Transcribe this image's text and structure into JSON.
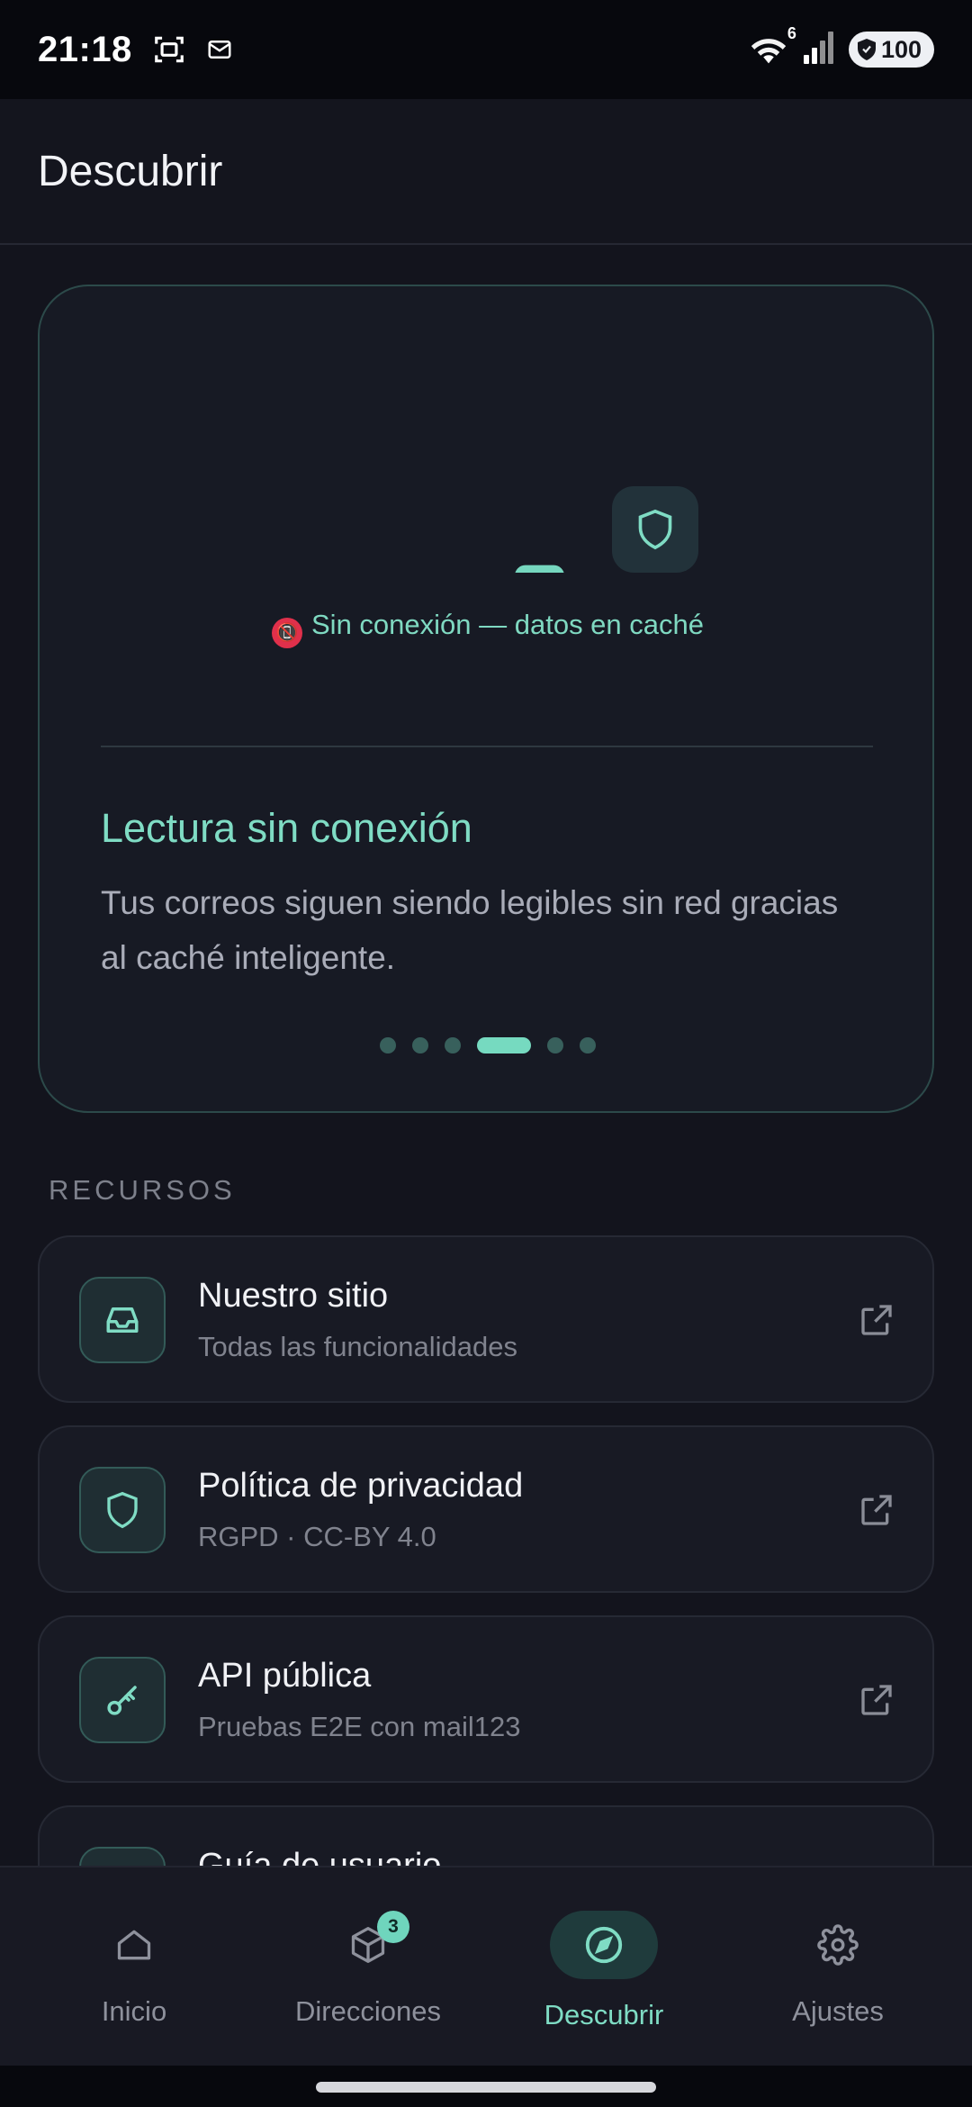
{
  "status_bar": {
    "time": "21:18",
    "network_label": "6",
    "battery": "100",
    "icons": [
      "screenshot-icon",
      "mail-icon",
      "wifi-icon",
      "signal-icon",
      "battery-icon"
    ]
  },
  "app_bar": {
    "title": "Descubrir"
  },
  "feature_card": {
    "status_text": "Sin conexión — datos en caché",
    "status_emoji": "📵",
    "heading": "Lectura sin conexión",
    "body": "Tus correos siguen siendo legibles sin red gracias al caché inteligente.",
    "pager": {
      "total": 6,
      "active_index": 3
    }
  },
  "resources": {
    "section_label": "RECURSOS",
    "items": [
      {
        "title": "Nuestro sitio",
        "subtitle": "Todas las funcionalidades",
        "icon": "inbox-icon"
      },
      {
        "title": "Política de privacidad",
        "subtitle": "RGPD · CC-BY 4.0",
        "icon": "shield-icon"
      },
      {
        "title": "API pública",
        "subtitle": "Pruebas E2E con mail123",
        "icon": "key-icon"
      },
      {
        "title": "Guía de usuario",
        "subtitle": "",
        "icon": "book-icon"
      }
    ]
  },
  "bottom_nav": {
    "items": [
      {
        "label": "Inicio",
        "icon": "home-icon"
      },
      {
        "label": "Direcciones",
        "icon": "box-icon",
        "badge": "3"
      },
      {
        "label": "Descubrir",
        "icon": "compass-icon",
        "active": true
      },
      {
        "label": "Ajustes",
        "icon": "settings-icon"
      }
    ]
  },
  "colors": {
    "background": "#13141d",
    "accent": "#7fdcc4",
    "card_border": "#2c4a4a",
    "status_bar": "#07080d"
  }
}
